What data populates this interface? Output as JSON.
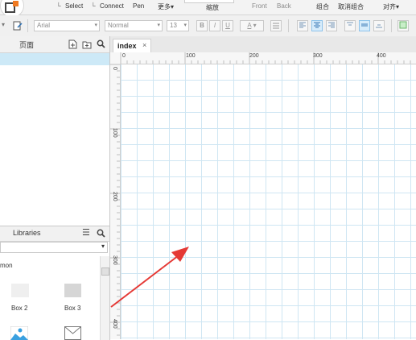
{
  "toolbar": {
    "select": "Select",
    "connect": "Connect",
    "pen": "Pen",
    "more": "更多",
    "more_arrow": "▾",
    "zoom": "缩放",
    "front": "Front",
    "back": "Back",
    "group": "组合",
    "ungroup": "取消组合",
    "align": "对齐",
    "align_arrow": "▾"
  },
  "format_bar": {
    "font": "Arial",
    "style": "Normal",
    "size": "13",
    "bold": "B",
    "italic": "I",
    "underline": "U"
  },
  "pages_panel": {
    "title": "页面"
  },
  "libraries_panel": {
    "title": "Libraries",
    "group_label": "mon",
    "items": [
      {
        "label": "Box 2"
      },
      {
        "label": "Box 3"
      }
    ]
  },
  "canvas": {
    "tab_label": "index",
    "tab_close": "×",
    "h_ruler_labels": [
      "0",
      "100",
      "200",
      "300",
      "400"
    ],
    "v_ruler_labels": [
      "0",
      "100",
      "200",
      "300",
      "400"
    ]
  },
  "colors": {
    "annotation_arrow": "#e53935",
    "grid_line": "#cfe6f3",
    "selected_page": "#cde9f7"
  }
}
